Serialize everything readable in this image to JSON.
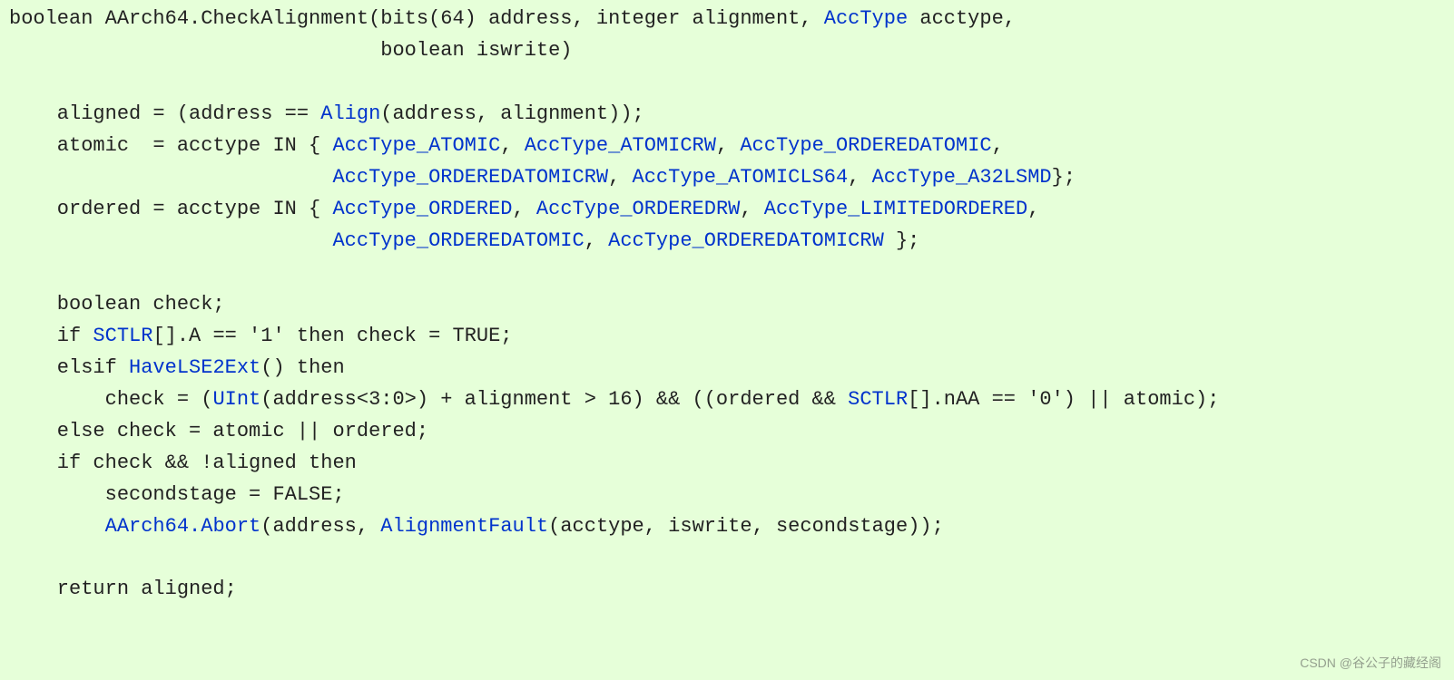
{
  "sig": {
    "t0": "boolean AArch64.CheckAlignment(bits(64) address, integer alignment, ",
    "t1": "AccType",
    "t2": " acctype,",
    "t3": "                               boolean iswrite)"
  },
  "l_blank1": "",
  "l_aligned": {
    "t0": "    aligned = (address == ",
    "t1": "Align",
    "t2": "(address, alignment));"
  },
  "l_atomic1": {
    "t0": "    atomic  = acctype IN { ",
    "t1": "AccType_ATOMIC",
    "t2": ", ",
    "t3": "AccType_ATOMICRW",
    "t4": ", ",
    "t5": "AccType_ORDEREDATOMIC",
    "t6": ","
  },
  "l_atomic2": {
    "t0": "                           ",
    "t1": "AccType_ORDEREDATOMICRW",
    "t2": ", ",
    "t3": "AccType_ATOMICLS64",
    "t4": ", ",
    "t5": "AccType_A32LSMD",
    "t6": "};"
  },
  "l_ordered1": {
    "t0": "    ordered = acctype IN { ",
    "t1": "AccType_ORDERED",
    "t2": ", ",
    "t3": "AccType_ORDEREDRW",
    "t4": ", ",
    "t5": "AccType_LIMITEDORDERED",
    "t6": ","
  },
  "l_ordered2": {
    "t0": "                           ",
    "t1": "AccType_ORDEREDATOMIC",
    "t2": ", ",
    "t3": "AccType_ORDEREDATOMICRW",
    "t4": " };"
  },
  "l_blank2": "",
  "l_decl": "    boolean check;",
  "l_ifsctlr": {
    "t0": "    if ",
    "t1": "SCTLR",
    "t2": "[].A == '1' then check = TRUE;"
  },
  "l_elsif": {
    "t0": "    elsif ",
    "t1": "HaveLSE2Ext",
    "t2": "() then"
  },
  "l_checkeq": {
    "t0": "        check = (",
    "t1": "UInt",
    "t2": "(address<3:0>) + alignment > 16) && ((ordered && ",
    "t3": "SCTLR",
    "t4": "[].nAA == '0') || atomic);"
  },
  "l_else": "    else check = atomic || ordered;",
  "l_ifcheck": "    if check && !aligned then",
  "l_second": "        secondstage = FALSE;",
  "l_abort": {
    "t0": "        ",
    "t1": "AArch64.Abort",
    "t2": "(address, ",
    "t3": "AlignmentFault",
    "t4": "(acctype, iswrite, secondstage));"
  },
  "l_blank3": "",
  "l_return": "    return aligned;",
  "watermark": "CSDN @谷公子的藏经阁"
}
